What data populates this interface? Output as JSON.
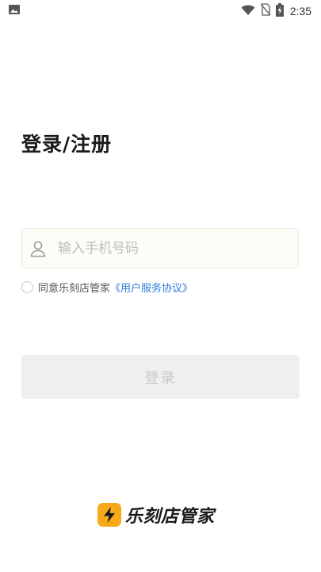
{
  "status_bar": {
    "time": "2:35",
    "icons": [
      "image-icon",
      "wifi-icon",
      "no-sim-icon",
      "battery-charging-icon"
    ]
  },
  "login": {
    "title": "登录/注册",
    "phone_placeholder": "输入手机号码",
    "agreement_text": "同意乐刻店管家",
    "agreement_link": "《用户服务协议》",
    "submit_label": "登录"
  },
  "brand": {
    "name": "乐刻店管家",
    "logo_icon": "lightning-icon",
    "logo_color": "#f7a81b"
  },
  "colors": {
    "link": "#2f7be0",
    "button_disabled_bg": "#efefef",
    "button_disabled_text": "#c9c9c9"
  }
}
